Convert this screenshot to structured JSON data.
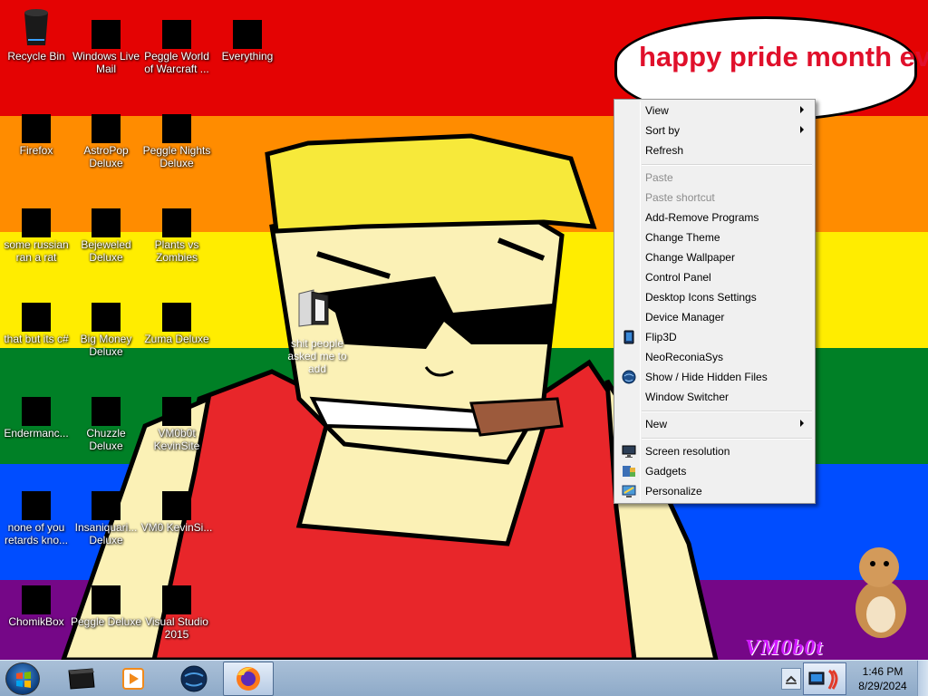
{
  "desktop": {
    "speech_bubble": "happy pride month everyone!",
    "folder_label": "shit people asked me to add",
    "signature": "VM0b0t",
    "icons": [
      {
        "label": "Recycle Bin"
      },
      {
        "label": "Windows Live Mail"
      },
      {
        "label": "Peggle World of Warcraft ..."
      },
      {
        "label": "Everything"
      },
      {
        "label": "Firefox"
      },
      {
        "label": "AstroPop Deluxe"
      },
      {
        "label": "Peggle Nights Deluxe"
      },
      {
        "label": "some russian ran a rat"
      },
      {
        "label": "Bejeweled Deluxe"
      },
      {
        "label": "Plants vs Zombies"
      },
      {
        "label": "that but its c#"
      },
      {
        "label": "Big Money Deluxe"
      },
      {
        "label": "Zuma Deluxe"
      },
      {
        "label": "Endermanc..."
      },
      {
        "label": "Chuzzle Deluxe"
      },
      {
        "label": "VM0b0t KevinSite"
      },
      {
        "label": "none of you retards kno..."
      },
      {
        "label": "Insaniquari... Deluxe"
      },
      {
        "label": "VM0 KevinSi..."
      },
      {
        "label": "ChomikBox"
      },
      {
        "label": "Peggle Deluxe"
      },
      {
        "label": "Visual Studio 2015"
      }
    ]
  },
  "context_menu": {
    "items": [
      {
        "label": "View",
        "submenu": true
      },
      {
        "label": "Sort by",
        "submenu": true
      },
      {
        "label": "Refresh"
      },
      {
        "label": "Paste",
        "disabled": true
      },
      {
        "label": "Paste shortcut",
        "disabled": true
      },
      {
        "label": "Add-Remove Programs"
      },
      {
        "label": "Change Theme"
      },
      {
        "label": "Change Wallpaper"
      },
      {
        "label": "Control Panel"
      },
      {
        "label": "Desktop Icons Settings"
      },
      {
        "label": "Device Manager"
      },
      {
        "label": "Flip3D",
        "icon": "flip3d-icon"
      },
      {
        "label": "NeoReconiaSys"
      },
      {
        "label": "Show / Hide Hidden Files",
        "icon": "globe-icon"
      },
      {
        "label": "Window Switcher"
      },
      {
        "label": "New",
        "submenu": true
      },
      {
        "label": "Screen resolution",
        "icon": "monitor-icon"
      },
      {
        "label": "Gadgets",
        "icon": "gadgets-icon"
      },
      {
        "label": "Personalize",
        "icon": "personalize-icon"
      }
    ]
  },
  "taskbar": {
    "time": "1:46 PM",
    "date": "8/29/2024"
  },
  "colors": {
    "stripes": [
      "#e40303",
      "#ff8c00",
      "#ffed00",
      "#008026",
      "#004dff",
      "#750787"
    ],
    "bubble_text": "#e0102b"
  }
}
